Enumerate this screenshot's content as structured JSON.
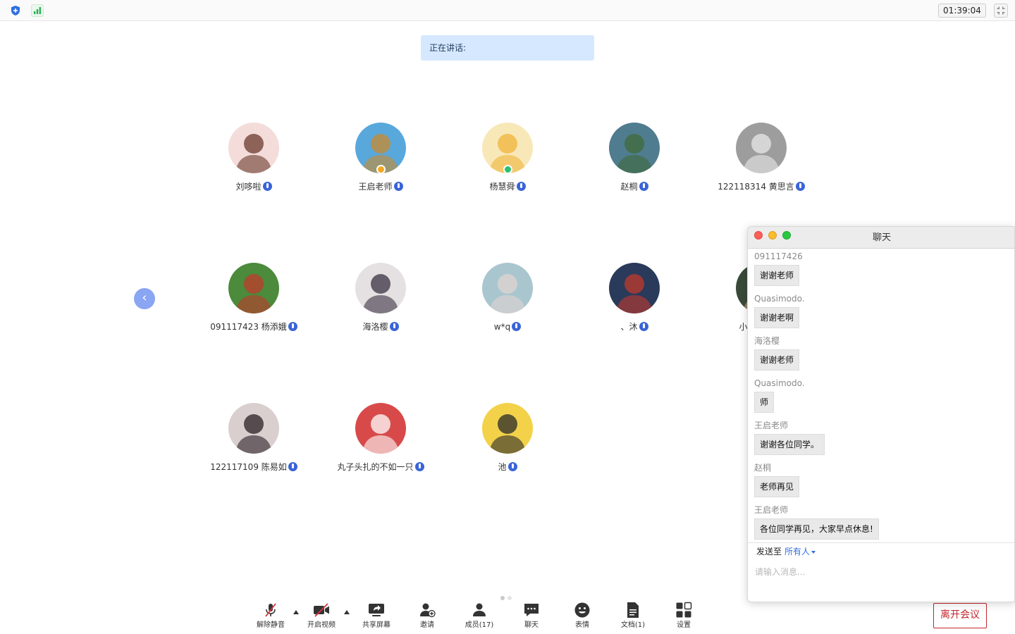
{
  "topbar": {
    "timer": "01:39:04"
  },
  "speaking": {
    "label": "正在讲话:"
  },
  "participants": [
    {
      "name": "刘哆啦",
      "avatar_bg": "#f3dcd9",
      "avatar_fg": "#6b3a2c",
      "badge": null
    },
    {
      "name": "王启老师",
      "avatar_bg": "#58a8dc",
      "avatar_fg": "#c98a2c",
      "badge": "#f5a623"
    },
    {
      "name": "杨慧舜",
      "avatar_bg": "#f8e8b8",
      "avatar_fg": "#f0b43a",
      "badge": "#2bbf72"
    },
    {
      "name": "赵桐",
      "avatar_bg": "#4f7c8f",
      "avatar_fg": "#3f6b3a",
      "badge": null
    },
    {
      "name": "122118314 黄思言",
      "avatar_bg": "#9d9d9d",
      "avatar_fg": "#e8e8e8",
      "badge": null
    },
    {
      "name": "091117423 杨添娥",
      "avatar_bg": "#4c8a3c",
      "avatar_fg": "#c0392b",
      "badge": null
    },
    {
      "name": "海洛樱",
      "avatar_bg": "#e5e1e3",
      "avatar_fg": "#3a3040",
      "badge": null
    },
    {
      "name": "w*q",
      "avatar_bg": "#a9c6cf",
      "avatar_fg": "#e2d4d0",
      "badge": null
    },
    {
      "name": "、沐",
      "avatar_bg": "#2a3a5a",
      "avatar_fg": "#c0392b",
      "badge": null
    },
    {
      "name": "小智姐姐",
      "avatar_bg": "#3a4a3a",
      "avatar_fg": "#c9a08a",
      "badge": null
    },
    {
      "name": "122117109 陈易如",
      "avatar_bg": "#d9cfcf",
      "avatar_fg": "#2a2024",
      "badge": null
    },
    {
      "name": "丸子头扎的不如一只",
      "avatar_bg": "#d84a4a",
      "avatar_fg": "#ffffff",
      "badge": null
    },
    {
      "name": "池",
      "avatar_bg": "#f3d24a",
      "avatar_fg": "#2a2a2a",
      "badge": null
    }
  ],
  "toolbar": {
    "unmute": "解除静音",
    "start_video": "开启视频",
    "share_screen": "共享屏幕",
    "invite": "邀请",
    "members": "成员(17)",
    "chat": "聊天",
    "reactions": "表情",
    "docs": "文档(1)",
    "settings": "设置",
    "leave": "离开会议"
  },
  "chat": {
    "title": "聊天",
    "messages": [
      {
        "sender": "091117426",
        "text": "谢谢老师"
      },
      {
        "sender": "Quasimodo.",
        "text": "谢谢老啊"
      },
      {
        "sender": "海洛樱",
        "text": "谢谢老师"
      },
      {
        "sender": "Quasimodo.",
        "text": "师"
      },
      {
        "sender": "王启老师",
        "text": "谢谢各位同学。"
      },
      {
        "sender": "赵桐",
        "text": "老师再见"
      },
      {
        "sender": "王启老师",
        "text": "各位同学再见，大家早点休息!"
      }
    ],
    "send_to_label": "发送至",
    "send_to_target": "所有人",
    "input_placeholder": "请输入消息..."
  },
  "colors": {
    "accent": "#3a64d8",
    "leave": "#c2272d",
    "speaking_bg": "#d6e8ff"
  }
}
